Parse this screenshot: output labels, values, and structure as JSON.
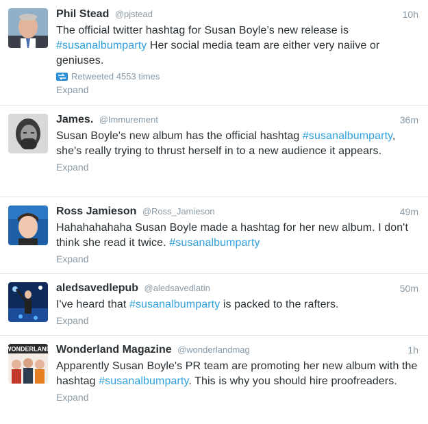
{
  "tweets": [
    {
      "name": "Phil Stead",
      "handle": "@pjstead",
      "time": "10h",
      "text_before": "The official twitter hashtag for Susan Boyle’s new release is ",
      "hashtag": "#susanalbumparty",
      "text_after": " Her social media team are either very naiive or geniuses.",
      "retweeted": "Retweeted 4553 times",
      "expand": "Expand"
    },
    {
      "name": "James.",
      "handle": "@Immurement",
      "time": "36m",
      "text_before": "Susan Boyle's new album has the official hashtag ",
      "hashtag": "#susanalbumparty",
      "text_after": ", she's really trying to thrust herself in to a new audience it appears.",
      "expand": "Expand"
    },
    {
      "name": "Ross Jamieson",
      "handle": "@Ross_Jamieson",
      "time": "49m",
      "text_before": "Hahahahahaha Susan Boyle made a hashtag for her new album. I don't think she read it twice. ",
      "hashtag": "#susanalbumparty",
      "text_after": "",
      "expand": "Expand"
    },
    {
      "name": "aledsavedlepub",
      "handle": "@aledsavedlatin",
      "time": "50m",
      "text_before": "I've heard that ",
      "hashtag": "#susanalbumparty",
      "text_after": " is packed to the rafters.",
      "expand": "Expand"
    },
    {
      "name": "Wonderland Magazine",
      "handle": "@wonderlandmag",
      "time": "1h",
      "text_before": "Apparently Susan Boyle's PR team are promoting her new album with the hashtag ",
      "hashtag": "#susanalbumparty",
      "text_after": ". This is why you should hire proofreaders.",
      "expand": "Expand",
      "avatar_text": "WONDERLAND"
    }
  ],
  "colors": {
    "hashtag": "#2fa0dc",
    "meta": "#8899a6",
    "name": "#292f33",
    "retweet_icon": "#2b90d9"
  }
}
